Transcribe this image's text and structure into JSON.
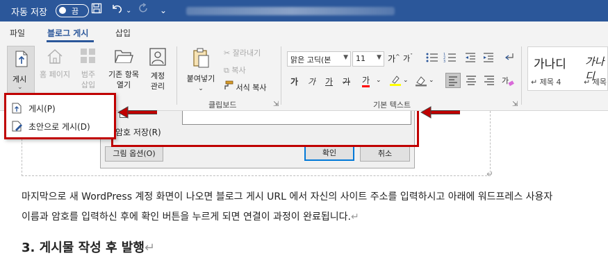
{
  "titlebar": {
    "autosave_label": "자동 저장",
    "toggle_state": "끔",
    "more_glyph": "⌄"
  },
  "menu": {
    "tabs": [
      "파일",
      "블로그 게시",
      "삽입"
    ],
    "active_tab": "블로그 게시"
  },
  "ribbon": {
    "blog_group": {
      "publish_label": "게시",
      "home_page_label": "홈 페이지",
      "category_label_1": "범주",
      "category_label_2": "삽입",
      "open_existing_label_1": "기존 항목",
      "open_existing_label_2": "열기",
      "manage_accounts_label_1": "계정",
      "manage_accounts_label_2": "관리"
    },
    "clipboard": {
      "paste_label": "붙여넣기",
      "cut_label": "잘라내기",
      "copy_label": "복사",
      "format_painter_label": "서식 복사",
      "group_label": "클립보드"
    },
    "basic_text": {
      "font_name": "맑은 고딕(본",
      "font_size": "11",
      "grow": "가",
      "shrink": "가",
      "bold": "가",
      "italic": "가",
      "underline": "가",
      "strike": "가",
      "font_color_glyph": "가",
      "group_label": "기본 텍스트"
    },
    "styles": {
      "style1_sample": "가나디",
      "style1_name": "제목 4",
      "style2_sample": "가나디",
      "style2_name": "제목"
    }
  },
  "dropdown": {
    "items": [
      "게시(P)",
      "초안으로 게시(D)"
    ]
  },
  "dialog": {
    "save_password_label": "암호 저장(R)",
    "picture_options_label": "그림 옵션(O)",
    "ok_label": "확인",
    "cancel_label": "취소"
  },
  "document": {
    "paragraph_line_1": "마지막으로 새 WordPress 계정 화면이 나오면 블로그 게시 URL 에서 자신의 사이트 주소를 입력하시고 아래에 워드프레스 사용자",
    "paragraph_line_2": "이름과 암호를 입력하신 후에 확인 버튼을 누르게 되면 연결이 과정이 완료됩니다.",
    "heading": "3. 게시물 작성 후 발행",
    "paragraph_mark": "↵"
  },
  "colors": {
    "title_bar": "#2b579a",
    "highlight_red": "#c00000",
    "font_color_red": "#ff0000",
    "highlight_yellow": "#ffff00"
  }
}
